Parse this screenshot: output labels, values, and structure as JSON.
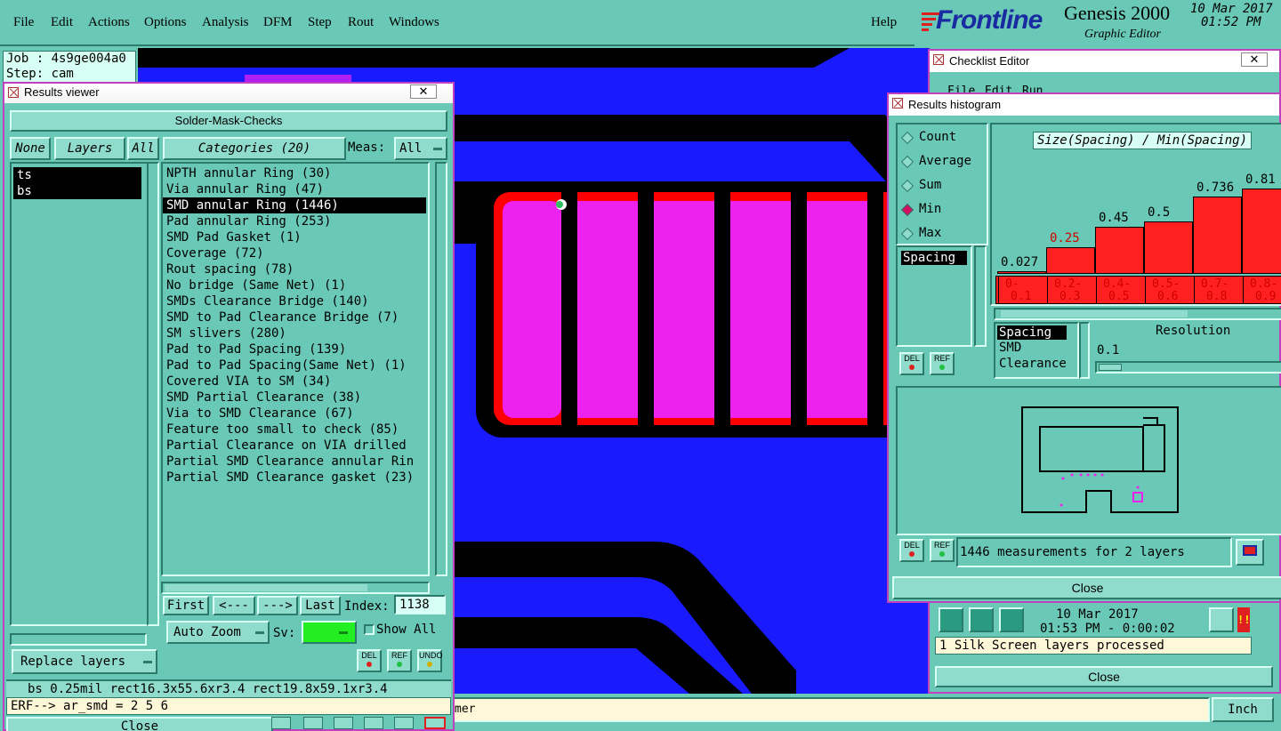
{
  "menubar": {
    "items": [
      "File",
      "Edit",
      "Actions",
      "Options",
      "Analysis",
      "DFM",
      "Step",
      "Rout",
      "Windows"
    ],
    "help": "Help",
    "brand": "Frontline",
    "product": "Genesis 2000",
    "subtitle": "Graphic Editor",
    "date": "10 Mar 2017",
    "time": "01:52 PM"
  },
  "jobinfo": {
    "job": "Job : 4s9ge004a0",
    "step": "Step: cam"
  },
  "results_viewer": {
    "title": "Results viewer",
    "header": "Solder-Mask-Checks",
    "none_btn": "None",
    "layers_btn": "Layers",
    "all_btn": "All",
    "categories_btn": "Categories (20)",
    "meas_label": "Meas:",
    "meas_value": "All",
    "layers": [
      "ts",
      "bs"
    ],
    "categories": [
      "NPTH annular Ring (30)",
      "Via annular Ring (47)",
      "SMD annular Ring (1446)",
      "Pad annular Ring (253)",
      "SMD Pad Gasket (1)",
      "Coverage (72)",
      "Rout spacing (78)",
      "No bridge (Same Net) (1)",
      "SMDs Clearance Bridge (140)",
      "SMD to Pad Clearance Bridge (7)",
      "SM slivers (280)",
      "Pad to Pad Spacing (139)",
      "Pad to Pad Spacing(Same Net) (1)",
      "Covered VIA to SM (34)",
      "SMD Partial Clearance (38)",
      "Via to SMD Clearance (67)",
      "Feature too small to check (85)",
      "Partial Clearance on VIA drilled",
      "Partial SMD Clearance annular Rin",
      "Partial SMD Clearance gasket (23)"
    ],
    "selected_category": 2,
    "first": "First",
    "prev": "<---",
    "next": "--->",
    "last": "Last",
    "index_label": "Index:",
    "index_value": "1138",
    "zoom": "Auto Zoom",
    "sv_label": "Sv:",
    "show_all": "Show All",
    "replace": "Replace layers",
    "status": "bs 0.25mil  rect16.3x55.6xr3.4  rect19.8x59.1xr3.4",
    "erf": "ERF--> ar_smd = 2 5 6",
    "close": "Close"
  },
  "checklist_editor": {
    "title": "Checklist Editor",
    "menu": [
      "File",
      "Edit",
      "Run"
    ],
    "date": "10 Mar 2017",
    "time": "01:53 PM - 0:00:02",
    "message": "1 Silk Screen layers processed",
    "close": "Close"
  },
  "histogram": {
    "title": "Results histogram",
    "options": [
      "Count",
      "Average",
      "Sum",
      "Min",
      "Max"
    ],
    "selected_option": "Min",
    "measure_list": [
      "Spacing"
    ],
    "chart_title": "Size(Spacing) / Min(Spacing)",
    "bins": [
      {
        "label": "0-\n0.1",
        "value": 0.027
      },
      {
        "label": "0.2-\n0.3",
        "value": 0.25
      },
      {
        "label": "0.4-\n0.5",
        "value": 0.45
      },
      {
        "label": "0.5-\n0.6",
        "value": 0.5
      },
      {
        "label": "0.7-\n0.8",
        "value": 0.736
      },
      {
        "label": "0.8-\n0.9",
        "value": 0.81
      }
    ],
    "bin_value_labels": [
      "0.027",
      "0.25",
      "0.45",
      "0.5",
      "0.736",
      "0.81"
    ],
    "bin_labels": [
      "0-",
      "0.2-",
      "0.4-",
      "0.5-",
      "0.7-",
      "0.8-"
    ],
    "bin_labels2": [
      "0.1",
      "0.3",
      "0.5",
      "0.6",
      "0.8",
      "0.9"
    ],
    "type_list": [
      "Spacing",
      "SMD",
      "Clearance"
    ],
    "resolution_label": "Resolution",
    "resolution_value": "0.1",
    "measurements": "1446 measurements for 2 layers",
    "close": "Close",
    "del": "DEL",
    "ref": "REF"
  },
  "bottom": {
    "units": "Inch",
    "partial_text": "mer"
  },
  "colors": {
    "canvas": "#1a1aff",
    "pad": "#ee22ee",
    "ring": "#ff0000",
    "panel": "#69c9b6"
  }
}
